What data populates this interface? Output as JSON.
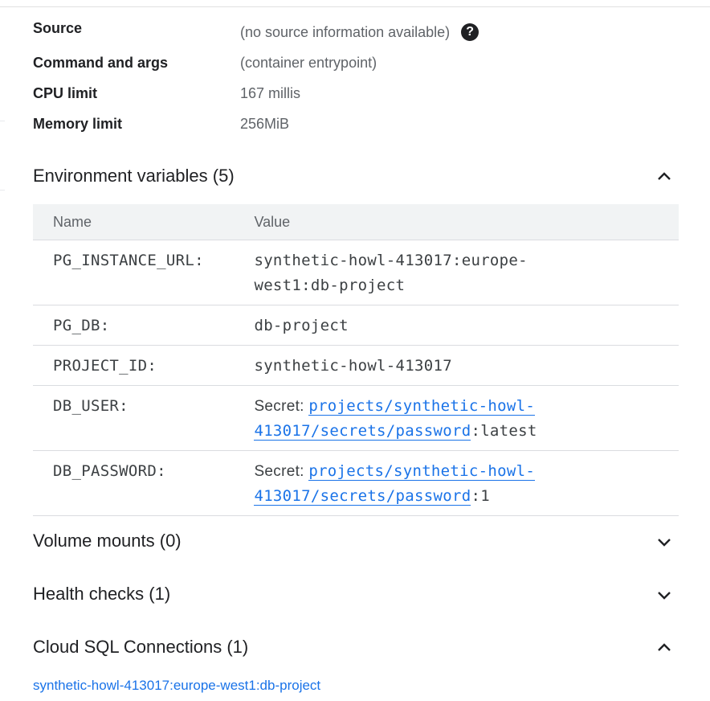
{
  "details": {
    "source_label": "Source",
    "source_value": "(no source information available)",
    "command_label": "Command and args",
    "command_value": "(container entrypoint)",
    "cpu_label": "CPU limit",
    "cpu_value": "167 millis",
    "memory_label": "Memory limit",
    "memory_value": "256MiB"
  },
  "env_section": {
    "title": "Environment variables (5)",
    "expanded": true,
    "columns": [
      "Name",
      "Value"
    ],
    "rows": [
      {
        "name": "PG_INSTANCE_URL:",
        "value_line1": "synthetic-howl-413017:europe-",
        "value_line2": "west1:db-project"
      },
      {
        "name": "PG_DB:",
        "value": "db-project"
      },
      {
        "name": "PROJECT_ID:",
        "value": "synthetic-howl-413017"
      },
      {
        "name": "DB_USER:",
        "secret_prefix": "Secret: ",
        "secret_link_line1": "projects/synthetic-howl-",
        "secret_link_line2": "413017/secrets/password",
        "secret_version": ":latest"
      },
      {
        "name": "DB_PASSWORD:",
        "secret_prefix": "Secret: ",
        "secret_link_line1": "projects/synthetic-howl-",
        "secret_link_line2": "413017/secrets/password",
        "secret_version": ":1"
      }
    ]
  },
  "volume_section": {
    "title": "Volume mounts (0)",
    "expanded": false
  },
  "health_section": {
    "title": "Health checks (1)",
    "expanded": false
  },
  "cloudsql_section": {
    "title": "Cloud SQL Connections (1)",
    "expanded": true,
    "connection": "synthetic-howl-413017:europe-west1:db-project"
  },
  "icons": {
    "help": "help-circle-icon",
    "collapse": "chevron-up-icon",
    "expand": "chevron-down-icon"
  },
  "colors": {
    "link": "#1a73e8",
    "header_bg": "#f1f3f4",
    "divider": "#dadce0"
  }
}
